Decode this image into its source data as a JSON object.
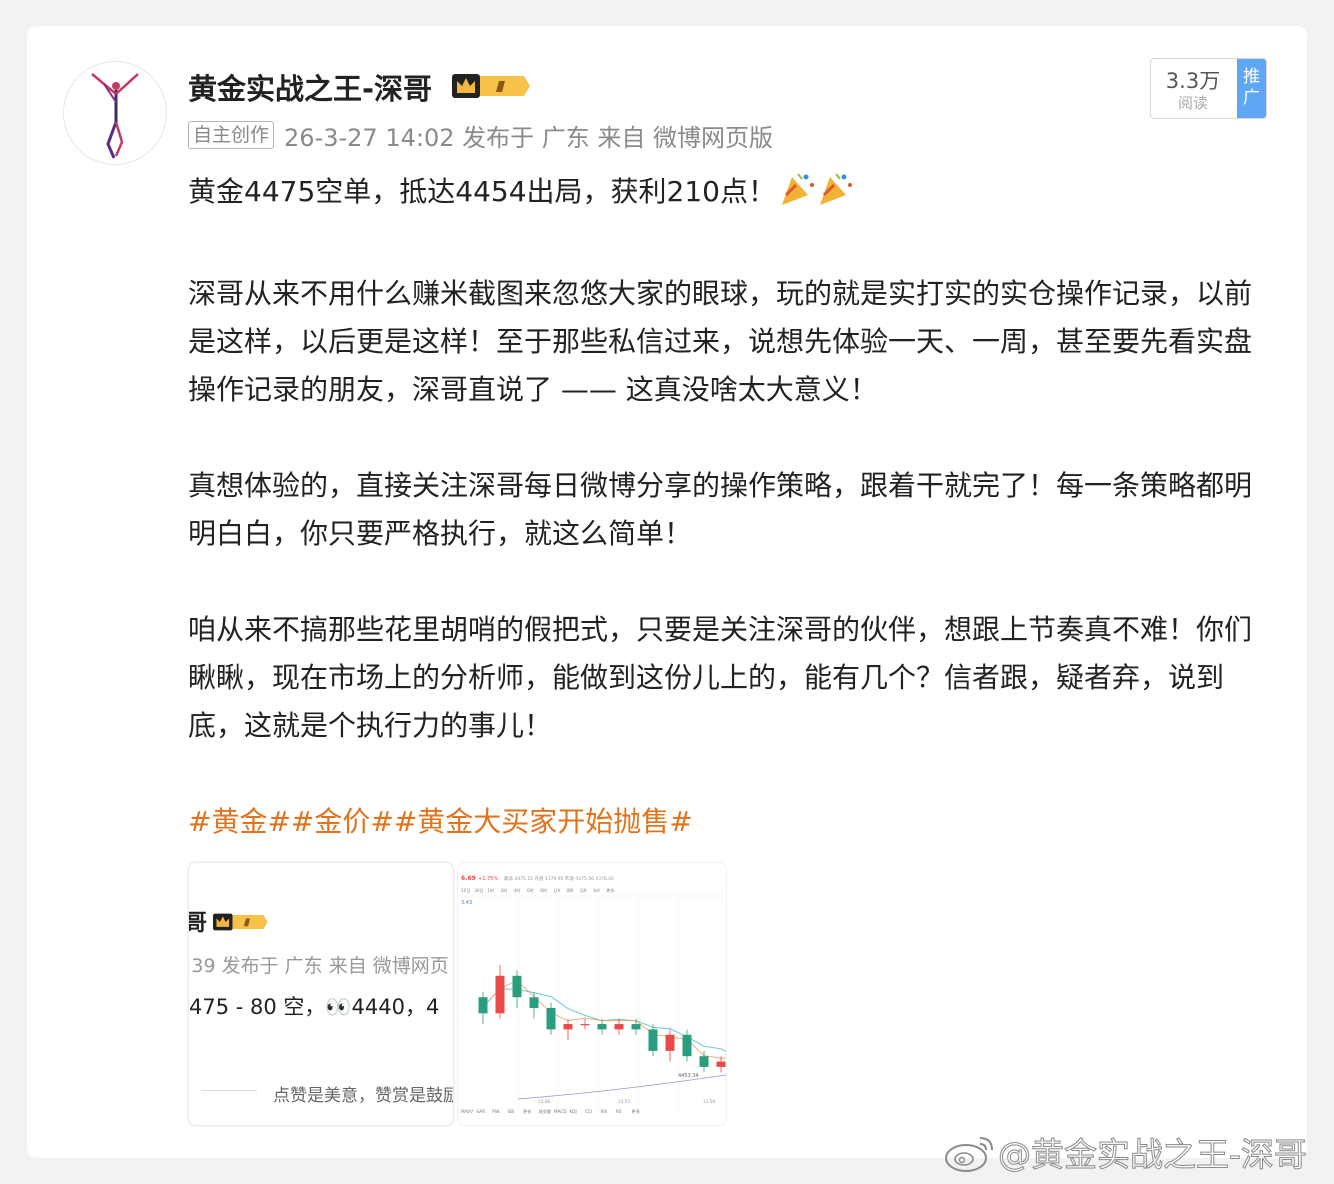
{
  "post": {
    "author": "黄金实战之王-深哥",
    "original_tag": "自主创作",
    "meta": "26-3-27 14:02  发布于 广东  来自 微博网页版",
    "reads": {
      "count": "3.3万",
      "label": "阅读",
      "promo": "推广"
    },
    "paragraphs": [
      "黄金4475空单，抵达4454出局，获利210点！",
      "深哥从来不用什么赚米截图来忽悠大家的眼球，玩的就是实打实的实仓操作记录，以前是这样，以后更是这样！至于那些私信过来，说想先体验一天、一周，甚至要先看实盘操作记录的朋友，深哥直说了 —— 这真没啥太大意义！",
      "真想体验的，直接关注深哥每日微博分享的操作策略，跟着干就完了！每一条策略都明明白白，你只要严格执行，就这么简单！",
      "咱从来不搞那些花里胡哨的假把式，只要是关注深哥的伙伴，想跟上节奏真不难！你们瞅瞅，现在市场上的分析师，能做到这份儿上的，能有几个？信者跟，疑者弃，说到底，这就是个执行力的事儿！"
    ],
    "hashtags": "#黄金##金价##黄金大买家开始抛售#"
  },
  "thumb1": {
    "name": "哥",
    "meta": ":39 发布于 广东  来自 微博网页",
    "content": "475 - 80 空，👀4440，4",
    "footer": "点赞是美意，赞赏是鼓励"
  },
  "thumb2": {
    "header_price": "6.69",
    "header_change": "+1.75%",
    "header_stats": "最高 4475.15  开盘 4379.95  昨收 4375.56  4378.00",
    "periods": [
      "20日",
      "30日",
      "1时",
      "2时",
      "4时",
      "6时",
      "8时",
      "日K",
      "周K",
      "月K",
      "年K",
      "更多"
    ],
    "low_label": "4453.34",
    "indicators": [
      "MAVV",
      "SAR",
      "PSK",
      "SBI",
      "更多",
      "成交量",
      "MACD",
      "KDJ",
      "CCI",
      "RSI",
      "RS",
      "更多"
    ],
    "time_labels": [
      "13:48",
      "13:53",
      "13:58"
    ],
    "candles": [
      {
        "o": 4466,
        "c": 4463,
        "h": 4467,
        "l": 4461
      },
      {
        "o": 4463,
        "c": 4470,
        "h": 4472,
        "l": 4462
      },
      {
        "o": 4470,
        "c": 4466,
        "h": 4471,
        "l": 4464
      },
      {
        "o": 4466,
        "c": 4464,
        "h": 4467,
        "l": 4462
      },
      {
        "o": 4464,
        "c": 4460,
        "h": 4465,
        "l": 4459
      },
      {
        "o": 4460,
        "c": 4461,
        "h": 4462,
        "l": 4458
      },
      {
        "o": 4461,
        "c": 4461,
        "h": 4462,
        "l": 4460
      },
      {
        "o": 4461,
        "c": 4460,
        "h": 4462,
        "l": 4459
      },
      {
        "o": 4460,
        "c": 4461,
        "h": 4462,
        "l": 4459
      },
      {
        "o": 4461,
        "c": 4460,
        "h": 4462,
        "l": 4459
      },
      {
        "o": 4460,
        "c": 4456,
        "h": 4461,
        "l": 4455
      },
      {
        "o": 4456,
        "c": 4459,
        "h": 4460,
        "l": 4454
      },
      {
        "o": 4459,
        "c": 4455,
        "h": 4460,
        "l": 4454
      },
      {
        "o": 4455,
        "c": 4453,
        "h": 4456,
        "l": 4452
      },
      {
        "o": 4453,
        "c": 4454,
        "h": 4455,
        "l": 4452
      },
      {
        "o": 4454,
        "c": 4453,
        "h": 4455,
        "l": 4452
      }
    ]
  },
  "watermark": "@黄金实战之王-深哥",
  "colors": {
    "hashtag": "#e2731d",
    "promo_bg": "#5ea7f5",
    "candle_up": "#e84a4a",
    "candle_down": "#2a9d7e"
  }
}
